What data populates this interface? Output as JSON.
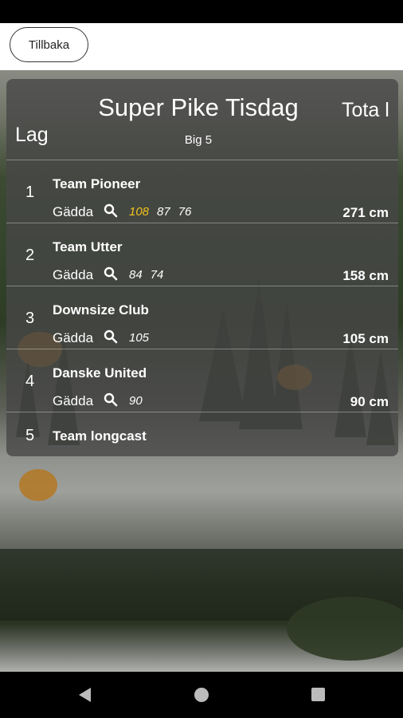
{
  "header": {
    "back_label": "Tillbaka"
  },
  "competition": {
    "title": "Super Pike Tisdag",
    "subtitle": "Big 5"
  },
  "columns": {
    "team": "Lag",
    "total": "Tota l"
  },
  "rows": [
    {
      "rank": "1",
      "team": "Team Pioneer",
      "species": "Gädda",
      "catches": [
        "108",
        "87",
        "76"
      ],
      "total": "271 cm",
      "icon": "search-icon"
    },
    {
      "rank": "2",
      "team": "Team Utter",
      "species": "Gädda",
      "catches": [
        "84",
        "74"
      ],
      "total": "158 cm",
      "icon": "search-icon"
    },
    {
      "rank": "3",
      "team": "Downsize Club",
      "species": "Gädda",
      "catches": [
        "105"
      ],
      "total": "105 cm",
      "icon": "search-icon"
    },
    {
      "rank": "4",
      "team": "Danske United",
      "species": "Gädda",
      "catches": [
        "90"
      ],
      "total": "90 cm",
      "icon": "search-icon"
    },
    {
      "rank": "5",
      "team": "Team longcast"
    }
  ],
  "colors": {
    "highlight": "#f2c21b",
    "panel": "rgba(70,70,70,0.78)"
  },
  "nav": {
    "back_icon": "back-triangle-icon",
    "home_icon": "home-circle-icon",
    "recents_icon": "recents-square-icon"
  }
}
